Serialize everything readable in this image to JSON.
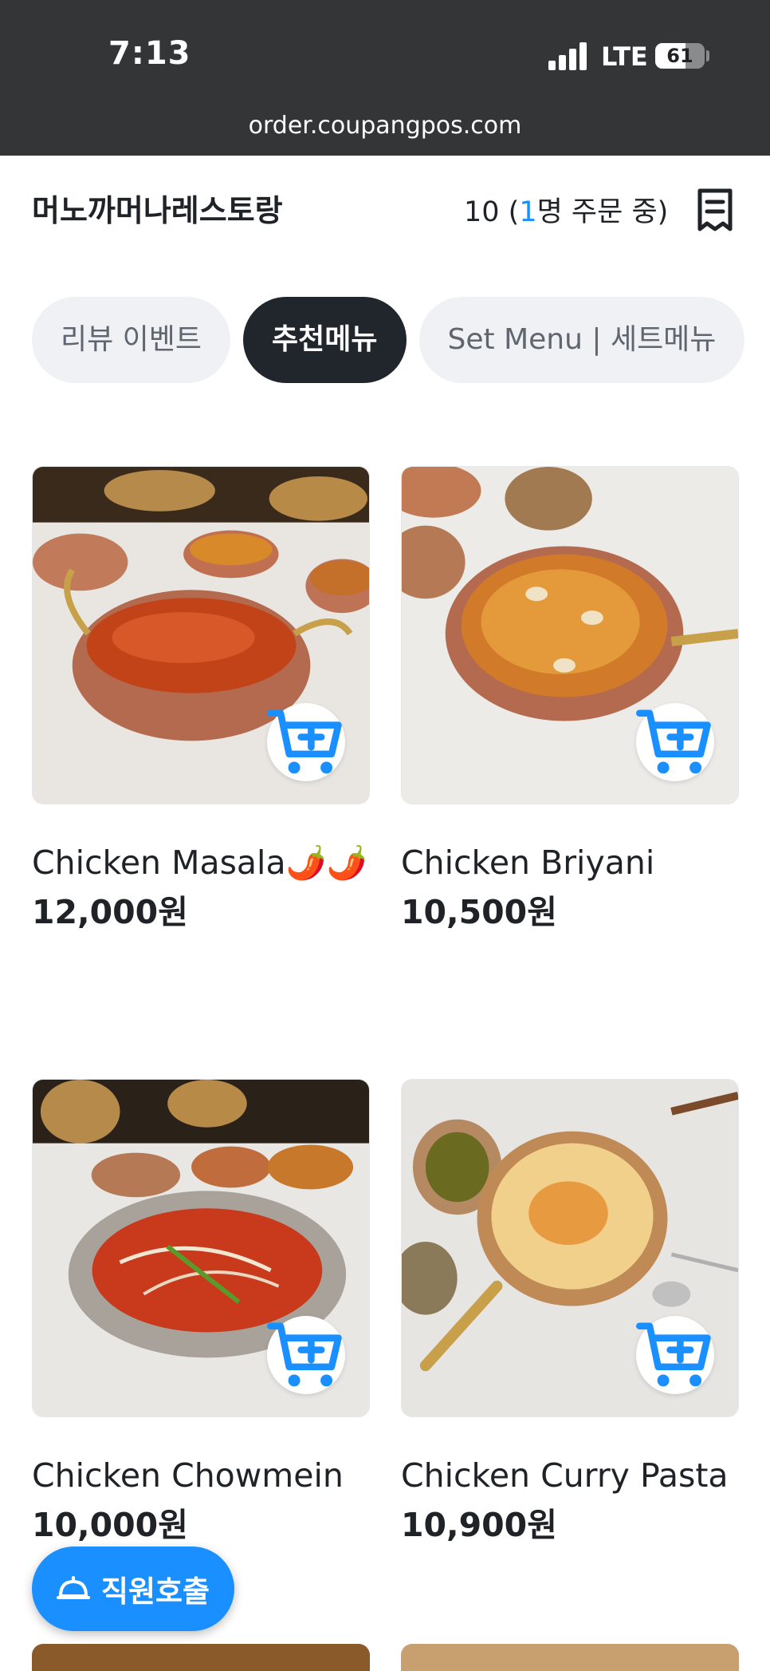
{
  "status_bar": {
    "time": "7:13",
    "network": "LTE",
    "battery": "61",
    "battery_level_percent": 61,
    "url": "order.coupangpos.com"
  },
  "header": {
    "restaurant_name": "머노까머나레스토랑",
    "table_number": "10 (",
    "people_count": "1",
    "ordering_suffix": "명 주문 중)",
    "receipt_icon": "receipt-icon"
  },
  "tabs": [
    {
      "label": "리뷰 이벤트",
      "active": false
    },
    {
      "label": "추천메뉴",
      "active": true
    },
    {
      "label": "Set Menu | 세트메뉴",
      "active": false
    }
  ],
  "menu_items": [
    {
      "name": "Chicken Masala🌶️🌶️",
      "price": "12,000원"
    },
    {
      "name": "Chicken Briyani",
      "price": "10,500원"
    },
    {
      "name": "Chicken Chowmein",
      "price": "10,000원"
    },
    {
      "name": "Chicken Curry Pasta",
      "price": "10,900원"
    }
  ],
  "call_staff_button": {
    "label": "직원호출",
    "icon": "bell-icon"
  },
  "colors": {
    "accent": "#1a8fff",
    "status_bar": "#333537",
    "active_tab": "#21262c",
    "inactive_tab": "#eff1f4"
  }
}
